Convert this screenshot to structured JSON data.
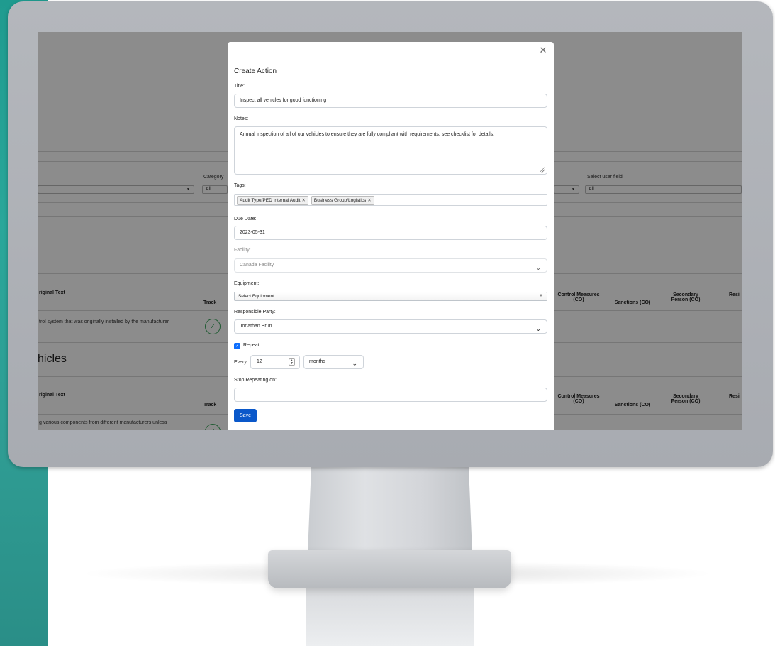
{
  "modal": {
    "title": "Create Action",
    "title_label": "Title:",
    "title_value": "Inspect all vehicles for good functioning",
    "notes_label": "Notes:",
    "notes_value": "Annual inspection of all of our vehicles to ensure they are fully compliant with requirements, see checklist for details.",
    "tags_label": "Tags:",
    "tags": [
      "Audit Type/PED Internal Audit",
      "Business Group/Logistics"
    ],
    "due_date_label": "Due Date:",
    "due_date_value": "2023-05-31",
    "facility_label": "Facility:",
    "facility_value": "Canada Facility",
    "equipment_label": "Equipment:",
    "equipment_value": "Select Equipment",
    "responsible_label": "Responsible Party:",
    "responsible_value": "Jonathan Brun",
    "repeat_label": "Repeat",
    "repeat_checked": true,
    "every_label": "Every",
    "every_value": "12",
    "every_unit": "months",
    "stop_label": "Stop Repeating on:",
    "stop_value": "",
    "save_label": "Save"
  },
  "background": {
    "category_label": "Category",
    "category_value": "All",
    "select_user_label": "Select user field",
    "select_user_value": "All",
    "section_heading": "hicles",
    "table": {
      "headers": [
        "riginal Text",
        "Track",
        "Control Measures (CO)",
        "Sanctions (CO)",
        "Secondary Person (CO)",
        "Resi"
      ],
      "row1_text": "trol system that was originally installed by the manufacturer",
      "row2_text": "g various components from different manufacturers unless",
      "dash": "..."
    }
  },
  "icons": [
    "close-icon",
    "tag-remove-icon",
    "chevron-down-icon",
    "checkbox-icon",
    "check-circle-icon",
    "info-icon"
  ],
  "colors": {
    "primary": "#0a58ca",
    "teal": "#2aa79a",
    "success": "#3aa65b"
  }
}
